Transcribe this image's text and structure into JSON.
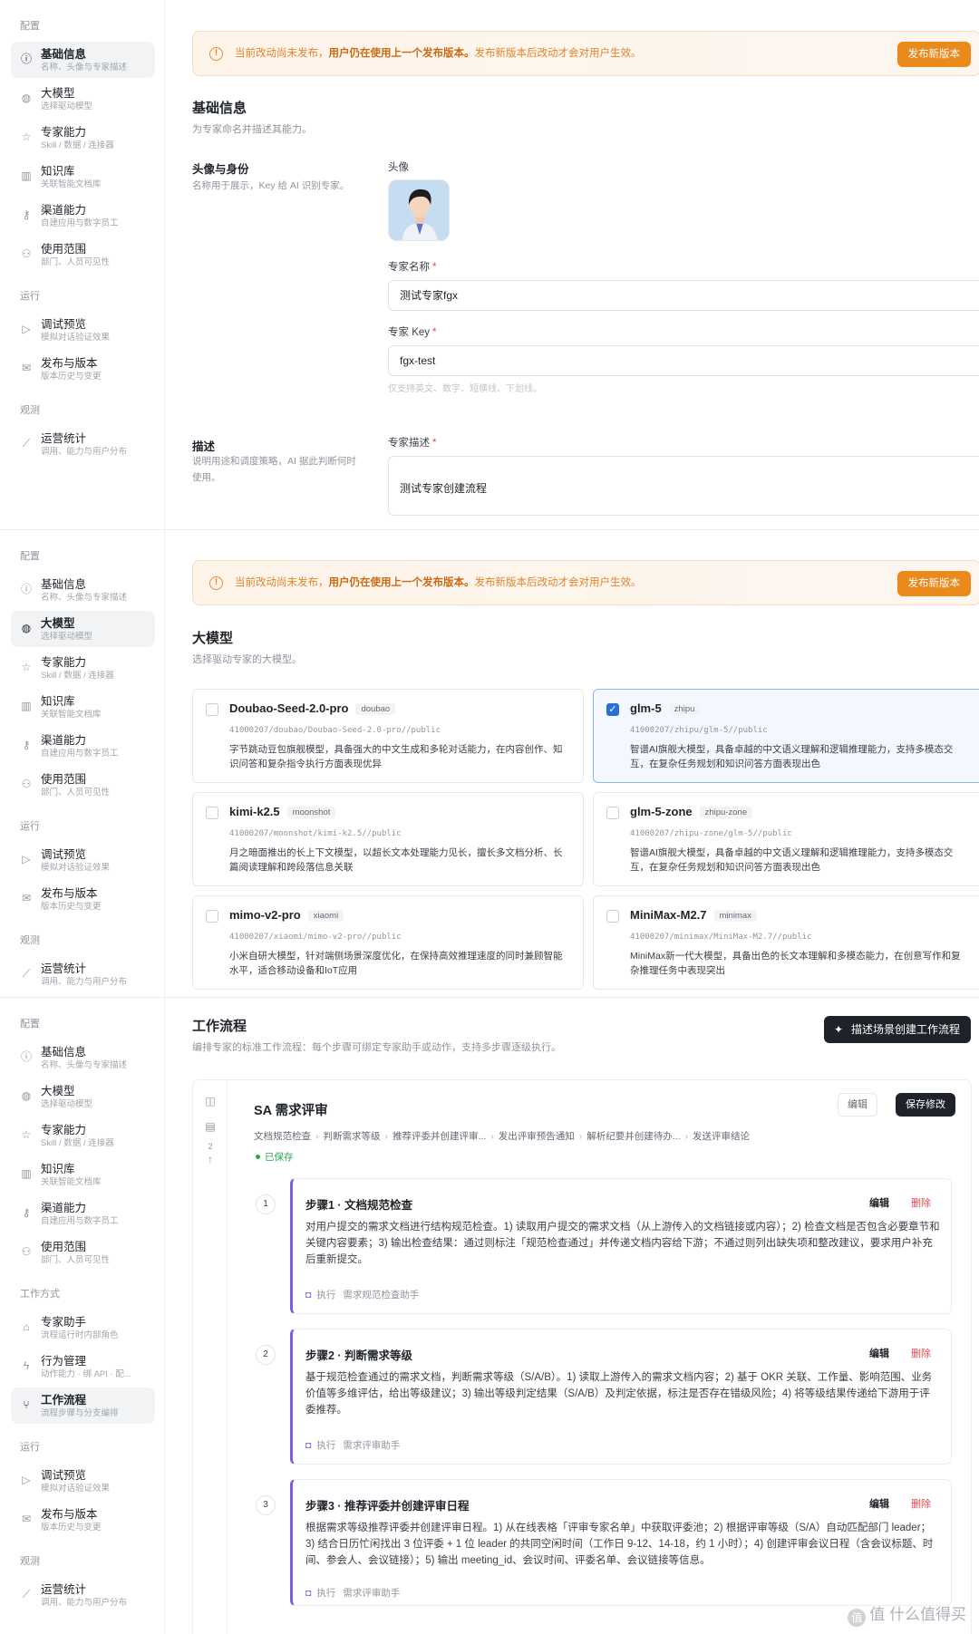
{
  "nav": {
    "sections": {
      "config": "配置",
      "run": "运行",
      "observe": "观测",
      "workmode": "工作方式"
    },
    "items": {
      "basic": {
        "label": "基础信息",
        "sub": "名称、头像与专家描述"
      },
      "model": {
        "label": "大模型",
        "sub": "选择驱动模型"
      },
      "skills": {
        "label": "专家能力",
        "sub": "Skill / 数据 / 连接器"
      },
      "kb": {
        "label": "知识库",
        "sub": "关联智能文档库"
      },
      "channel": {
        "label": "渠道能力",
        "sub": "自建应用与数字员工"
      },
      "scope": {
        "label": "使用范围",
        "sub": "部门、人员可见性"
      },
      "debug": {
        "label": "调试预览",
        "sub": "模拟对话验证效果"
      },
      "release": {
        "label": "发布与版本",
        "sub": "版本历史与变更"
      },
      "stats": {
        "label": "运营统计",
        "sub": "调用、能力与用户分布"
      },
      "assistant": {
        "label": "专家助手",
        "sub": "流程运行时内部角色"
      },
      "action": {
        "label": "行为管理",
        "sub": "动作能力 · 绑 API · 配..."
      },
      "workflow": {
        "label": "工作流程",
        "sub": "流程步骤与分支编排"
      }
    }
  },
  "banner": {
    "text_pre": "当前改动尚未发布，",
    "text_bold": "用户仍在使用上一个发布版本。",
    "text_post": "发布新版本后改动才会对用户生效。",
    "button": "发布新版本"
  },
  "basic": {
    "title": "基础信息",
    "subtitle": "为专家命名并描述其能力。",
    "identity_label": "头像与身份",
    "identity_desc": "名称用于展示，Key 给 AI 识别专家。",
    "avatar_label": "头像",
    "name_label": "专家名称",
    "name_value": "测试专家fgx",
    "key_label": "专家 Key",
    "key_value": "fgx-test",
    "key_hint": "仅支持英文、数字、短横线、下划线。",
    "desc_label": "描述",
    "desc_desc": "说明用途和调度策略，AI 据此判断何时使用。",
    "desc_field_label": "专家描述",
    "desc_value": "测试专家创建流程",
    "required_mark": "*"
  },
  "models": {
    "title": "大模型",
    "subtitle": "选择驱动专家的大模型。",
    "list": [
      {
        "name": "Doubao-Seed-2.0-pro",
        "tag": "doubao",
        "path": "41000207/doubao/Doubao-Seed-2.0-pro//public",
        "desc": "字节跳动豆包旗舰模型，具备强大的中文生成和多轮对话能力，在内容创作、知识问答和复杂指令执行方面表现优异",
        "selected": false
      },
      {
        "name": "glm-5",
        "tag": "zhipu",
        "path": "41000207/zhipu/glm-5//public",
        "desc": "智谱AI旗舰大模型，具备卓越的中文语义理解和逻辑推理能力，支持多模态交互，在复杂任务规划和知识问答方面表现出色",
        "selected": true
      },
      {
        "name": "kimi-k2.5",
        "tag": "moonshot",
        "path": "41000207/moonshot/kimi-k2.5//public",
        "desc": "月之暗面推出的长上下文模型，以超长文本处理能力见长，擅长多文档分析、长篇阅读理解和跨段落信息关联",
        "selected": false
      },
      {
        "name": "glm-5-zone",
        "tag": "zhipu-zone",
        "path": "41000207/zhipu-zone/glm-5//public",
        "desc": "智谱AI旗舰大模型，具备卓越的中文语义理解和逻辑推理能力，支持多模态交互，在复杂任务规划和知识问答方面表现出色",
        "selected": false
      },
      {
        "name": "mimo-v2-pro",
        "tag": "xiaomi",
        "path": "41000207/xiaomi/mimo-v2-pro//public",
        "desc": "小米自研大模型，针对端侧场景深度优化，在保持高效推理速度的同时兼顾智能水平，适合移动设备和IoT应用",
        "selected": false
      },
      {
        "name": "MiniMax-M2.7",
        "tag": "minimax",
        "path": "41000207/minimax/MiniMax-M2.7//public",
        "desc": "MiniMax新一代大模型，具备出色的长文本理解和多模态能力，在创意写作和复杂推理任务中表现突出",
        "selected": false
      }
    ]
  },
  "workflow": {
    "title": "工作流程",
    "subtitle": "编排专家的标准工作流程：每个步骤可绑定专家助手或动作，支持多步骤逐级执行。",
    "create_button": "描述场景创建工作流程",
    "flow_title": "SA 需求评审",
    "crumbs": [
      "文档规范检查",
      "判断需求等级",
      "推荐评委并创建评审...",
      "发出评审预告通知",
      "解析纪要并创建待办...",
      "发送评审结论"
    ],
    "saved": "已保存",
    "edit_button": "编辑",
    "save_button": "保存修改",
    "rail_count": "2",
    "steps": [
      {
        "num": "1",
        "title": "步骤1 · 文档规范检查",
        "edit": "编辑",
        "delete": "删除",
        "body": "对用户提交的需求文档进行结构规范检查。1) 读取用户提交的需求文档（从上游传入的文档链接或内容）；2) 检查文档是否包含必要章节和关键内容要素；3) 输出检查结果：通过则标注「规范检查通过」并传递文档内容给下游；不通过则列出缺失项和整改建议，要求用户补充后重新提交。",
        "exec_label": "执行",
        "assistant": "需求规范检查助手"
      },
      {
        "num": "2",
        "title": "步骤2 · 判断需求等级",
        "edit": "编辑",
        "delete": "删除",
        "body": "基于规范检查通过的需求文档，判断需求等级（S/A/B）。1) 读取上游传入的需求文档内容；2) 基于 OKR 关联、工作量、影响范围、业务价值等多维评估，给出等级建议；3) 输出等级判定结果（S/A/B）及判定依据，标注是否存在错级风险；4) 将等级结果传递给下游用于评委推荐。",
        "exec_label": "执行",
        "assistant": "需求评审助手"
      },
      {
        "num": "3",
        "title": "步骤3 · 推荐评委并创建评审日程",
        "edit": "编辑",
        "delete": "删除",
        "body": "根据需求等级推荐评委并创建评审日程。1) 从在线表格「评审专家名单」中获取评委池；2) 根据评审等级（S/A）自动匹配部门 leader；3) 结合日历忙闲找出 3 位评委 + 1 位 leader 的共同空闲时间（工作日 9-12、14-18，约 1 小时）；4) 创建评审会议日程（含会议标题、时间、参会人、会议链接）；5) 输出 meeting_id、会议时间、评委名单、会议链接等信息。",
        "exec_label": "执行",
        "assistant": "需求评审助手"
      }
    ]
  },
  "watermark": "值 什么值得买",
  "colors": {
    "accent_orange": "#ea8a1d",
    "selected_blue": "#2a6fd6",
    "step_purple": "#7c5ce0",
    "saved_green": "#2fa351",
    "danger_red": "#e5484d"
  }
}
